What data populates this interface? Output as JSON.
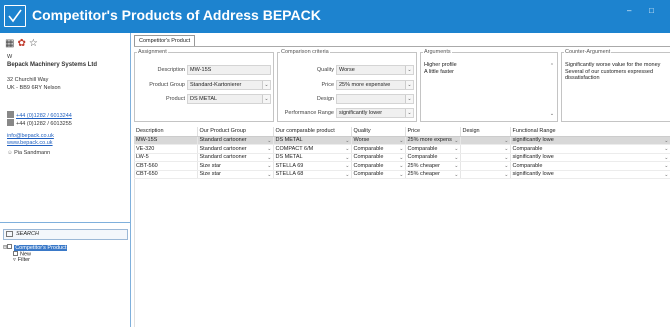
{
  "window": {
    "title": "Competitor's Products of Address BEPACK",
    "minimize": "–",
    "maximize": "□"
  },
  "address": {
    "short": "W",
    "company": "Bepack Machinery Systems Ltd",
    "street": "32 Churchill Way",
    "city": "UK - BB9 6RY Nelson",
    "phone": "+44 (0)1282 / 6013244",
    "fax": "+44 (0)1282 / 6013255",
    "email": "info@bepack.co.uk",
    "web": "www.bepack.co.uk",
    "contact": "Pia Sandmann"
  },
  "search": {
    "placeholder": "SEARCH"
  },
  "tree": [
    {
      "label": "Competitor's Product",
      "selected": true
    },
    {
      "label": "New",
      "selected": false
    },
    {
      "label": "Filter",
      "selected": false
    }
  ],
  "tab": {
    "label": "Competitor's Product"
  },
  "assignment": {
    "legend": "Assignment",
    "description_label": "Description",
    "description_value": "MW-15S",
    "product_group_label": "Product Group",
    "product_group_value": "Standard-Kartonierer",
    "product_label": "Product",
    "product_value": "DS METAL"
  },
  "comparison": {
    "legend": "Comparison criteria",
    "quality_label": "Quality",
    "quality_value": "Worse",
    "price_label": "Price",
    "price_value": "25% more expensive",
    "design_label": "Design",
    "design_value": "",
    "performance_label": "Performance Range",
    "performance_value": "significantly lower"
  },
  "arguments": {
    "legend": "Arguments",
    "line1": "Higher profile",
    "line2": "A little faster"
  },
  "counter": {
    "legend": "Counter-Argument",
    "line1": "Significantly worse value for the money",
    "line2": "Several of our customers expressed",
    "line3": "dissatisfaction"
  },
  "grid": {
    "headers": [
      "Description",
      "Our Product Group",
      "Our comparable product",
      "Quality",
      "Price",
      "Design",
      "Functional Range"
    ],
    "rows": [
      [
        "MW-15S",
        "Standard cartooner",
        "DS METAL",
        "Worse",
        "25% more expens",
        "",
        "significantly lowe"
      ],
      [
        "VE-320",
        "Standard cartooner",
        "COMPACT 6/M",
        "Comparable",
        "Comparable",
        "",
        "Comparable"
      ],
      [
        "LW-5",
        "Standard cartooner",
        "DS METAL",
        "Comparable",
        "Comparable",
        "",
        "significantly lowe"
      ],
      [
        "CBT-560",
        "Size star",
        "STELLA 69",
        "Comparable",
        "25% cheaper",
        "",
        "Comparable"
      ],
      [
        "CBT-650",
        "Size star",
        "STELLA  68",
        "Comparable",
        "25% cheaper",
        "",
        "significantly lowe"
      ]
    ]
  },
  "colors": {
    "titlebar": "#1d83cf",
    "selection": "#3a79c8",
    "row_selected": "#d8d8d8"
  }
}
